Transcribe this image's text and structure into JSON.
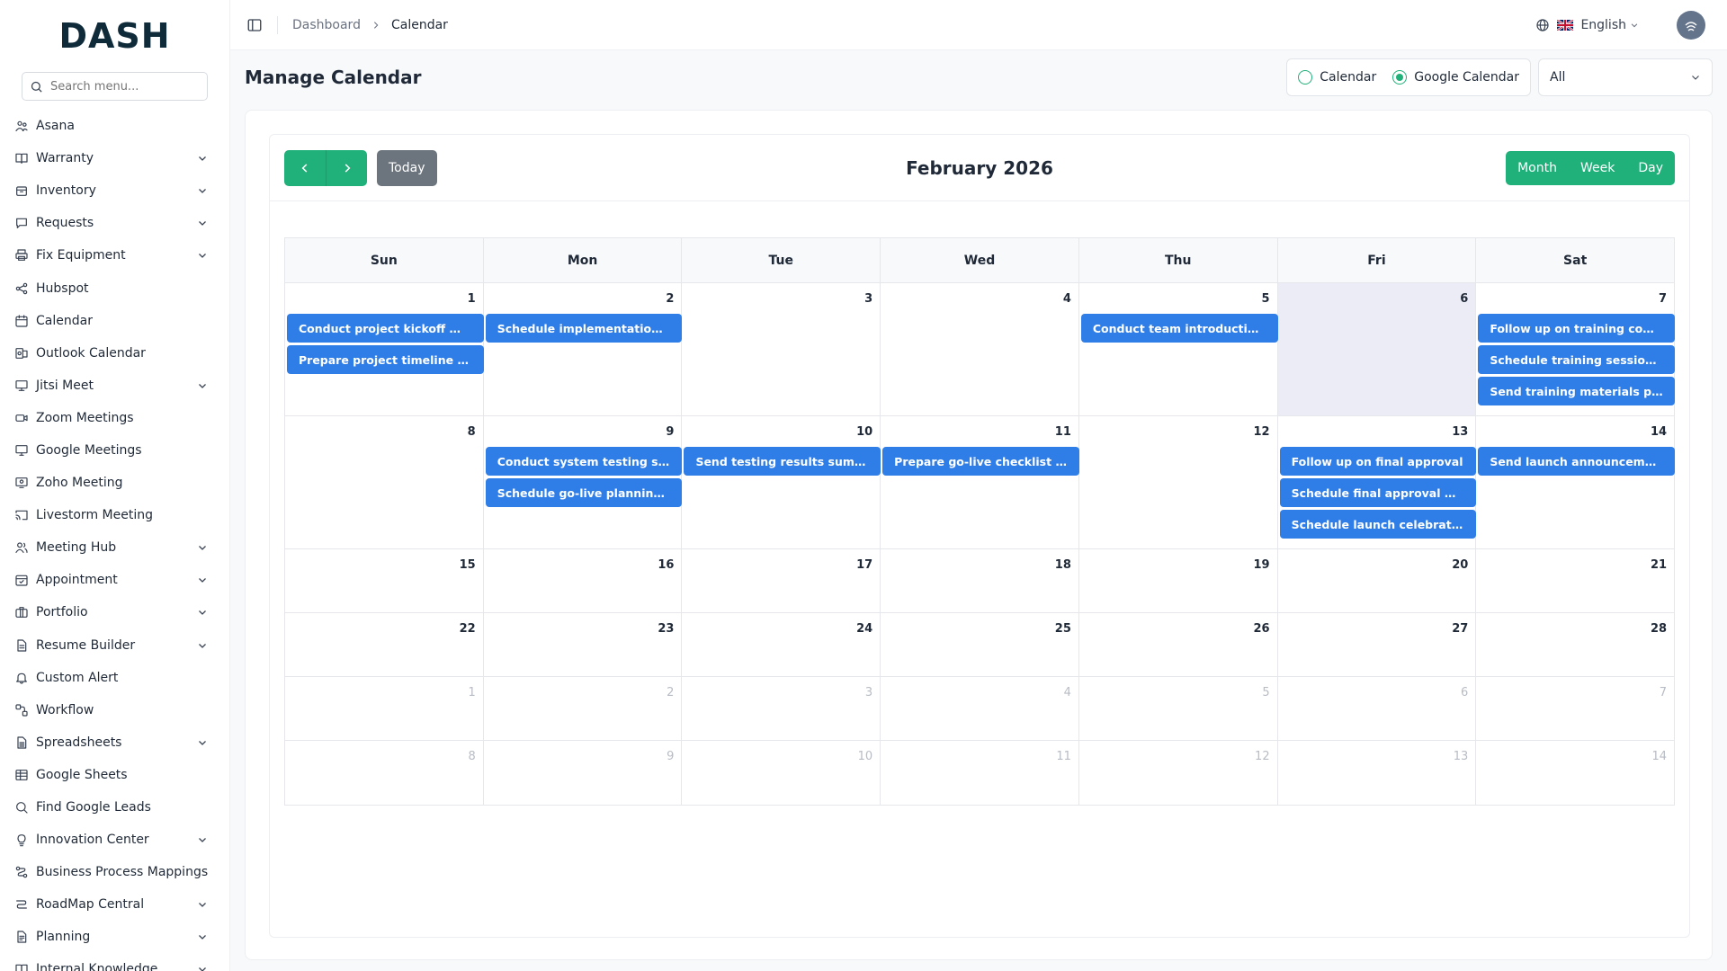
{
  "brand": {
    "logo": "DASH"
  },
  "search": {
    "placeholder": "Search menu..."
  },
  "sidebar": {
    "items": [
      {
        "label": "Asana",
        "icon": "people-icon",
        "chevron": false
      },
      {
        "label": "Warranty",
        "icon": "book-icon",
        "chevron": true
      },
      {
        "label": "Inventory",
        "icon": "box-icon",
        "chevron": true
      },
      {
        "label": "Requests",
        "icon": "message-icon",
        "chevron": true
      },
      {
        "label": "Fix Equipment",
        "icon": "printer-icon",
        "chevron": true
      },
      {
        "label": "Hubspot",
        "icon": "share-icon",
        "chevron": false
      },
      {
        "label": "Calendar",
        "icon": "calendar-icon",
        "chevron": false
      },
      {
        "label": "Outlook Calendar",
        "icon": "outlook-icon",
        "chevron": false
      },
      {
        "label": "Jitsi Meet",
        "icon": "presentation-icon",
        "chevron": true
      },
      {
        "label": "Zoom Meetings",
        "icon": "video-icon",
        "chevron": false
      },
      {
        "label": "Google Meetings",
        "icon": "monitor-icon",
        "chevron": false
      },
      {
        "label": "Zoho Meeting",
        "icon": "screen-share-icon",
        "chevron": false
      },
      {
        "label": "Livestorm Meeting",
        "icon": "cast-icon",
        "chevron": false
      },
      {
        "label": "Meeting Hub",
        "icon": "users-icon",
        "chevron": true
      },
      {
        "label": "Appointment",
        "icon": "calendar-check-icon",
        "chevron": true
      },
      {
        "label": "Portfolio",
        "icon": "briefcase-icon",
        "chevron": true
      },
      {
        "label": "Resume Builder",
        "icon": "file-icon",
        "chevron": true
      },
      {
        "label": "Custom Alert",
        "icon": "bell-icon",
        "chevron": false
      },
      {
        "label": "Workflow",
        "icon": "workflow-icon",
        "chevron": false
      },
      {
        "label": "Spreadsheets",
        "icon": "spreadsheet-icon",
        "chevron": true
      },
      {
        "label": "Google Sheets",
        "icon": "table-icon",
        "chevron": false
      },
      {
        "label": "Find Google Leads",
        "icon": "search-icon",
        "chevron": false
      },
      {
        "label": "Innovation Center",
        "icon": "lightbulb-icon",
        "chevron": true
      },
      {
        "label": "Business Process Mappings",
        "icon": "route-icon",
        "chevron": false
      },
      {
        "label": "RoadMap Central",
        "icon": "roadmap-icon",
        "chevron": true
      },
      {
        "label": "Planning",
        "icon": "file-text-icon",
        "chevron": true
      },
      {
        "label": "Internal Knowledge",
        "icon": "book-open-icon",
        "chevron": true
      }
    ]
  },
  "header": {
    "breadcrumb": {
      "home": "Dashboard",
      "current": "Calendar"
    },
    "language": "English"
  },
  "page": {
    "title": "Manage Calendar",
    "source_options": [
      {
        "label": "Calendar",
        "selected": false
      },
      {
        "label": "Google Calendar",
        "selected": true
      }
    ],
    "filter_value": "All"
  },
  "calendar": {
    "title": "February 2026",
    "today_label": "Today",
    "views": [
      "Month",
      "Week",
      "Day"
    ],
    "weekdays": [
      "Sun",
      "Mon",
      "Tue",
      "Wed",
      "Thu",
      "Fri",
      "Sat"
    ],
    "weeks": [
      {
        "days": [
          {
            "num": "1",
            "other": false,
            "events": [
              "Conduct project kickoff meeting"
            ]
          },
          {
            "num": "2",
            "other": false,
            "events": [
              "Schedule implementation planning"
            ]
          },
          {
            "num": "3",
            "other": false,
            "events": []
          },
          {
            "num": "4",
            "other": false,
            "events": []
          },
          {
            "num": "5",
            "other": false,
            "events": [
              "Conduct team introduction meeting"
            ]
          },
          {
            "num": "6",
            "other": false,
            "today": true,
            "events": []
          },
          {
            "num": "7",
            "other": false,
            "events": [
              "Follow up on training completion",
              "Schedule training session approval",
              "Send training materials package"
            ]
          }
        ],
        "extra": [
          {
            "day": 0,
            "slot": 1,
            "text": "Prepare project timeline document"
          }
        ]
      },
      {
        "days": [
          {
            "num": "8",
            "other": false,
            "events": []
          },
          {
            "num": "9",
            "other": false,
            "events": [
              "Conduct system testing session",
              "Schedule go-live planning meeting"
            ]
          },
          {
            "num": "10",
            "other": false,
            "events": [
              "Send testing results summary"
            ]
          },
          {
            "num": "11",
            "other": false,
            "events": [
              "Prepare go-live checklist document"
            ]
          },
          {
            "num": "12",
            "other": false,
            "events": []
          },
          {
            "num": "13",
            "other": false,
            "events": [
              "Follow up on final approval",
              "Schedule final approval meeting",
              "Schedule launch celebration event"
            ]
          },
          {
            "num": "14",
            "other": false,
            "events": [
              "Send launch announcement communication"
            ]
          }
        ]
      },
      {
        "days": [
          {
            "num": "15",
            "other": false,
            "events": []
          },
          {
            "num": "16",
            "other": false,
            "events": []
          },
          {
            "num": "17",
            "other": false,
            "events": []
          },
          {
            "num": "18",
            "other": false,
            "events": []
          },
          {
            "num": "19",
            "other": false,
            "events": []
          },
          {
            "num": "20",
            "other": false,
            "events": []
          },
          {
            "num": "21",
            "other": false,
            "events": []
          }
        ]
      },
      {
        "days": [
          {
            "num": "22",
            "other": false,
            "events": []
          },
          {
            "num": "23",
            "other": false,
            "events": []
          },
          {
            "num": "24",
            "other": false,
            "events": []
          },
          {
            "num": "25",
            "other": false,
            "events": []
          },
          {
            "num": "26",
            "other": false,
            "events": []
          },
          {
            "num": "27",
            "other": false,
            "events": []
          },
          {
            "num": "28",
            "other": false,
            "events": []
          }
        ]
      },
      {
        "days": [
          {
            "num": "1",
            "other": true,
            "events": []
          },
          {
            "num": "2",
            "other": true,
            "events": []
          },
          {
            "num": "3",
            "other": true,
            "events": []
          },
          {
            "num": "4",
            "other": true,
            "events": []
          },
          {
            "num": "5",
            "other": true,
            "events": []
          },
          {
            "num": "6",
            "other": true,
            "events": []
          },
          {
            "num": "7",
            "other": true,
            "events": []
          }
        ]
      },
      {
        "days": [
          {
            "num": "8",
            "other": true,
            "events": []
          },
          {
            "num": "9",
            "other": true,
            "events": []
          },
          {
            "num": "10",
            "other": true,
            "events": []
          },
          {
            "num": "11",
            "other": true,
            "events": []
          },
          {
            "num": "12",
            "other": true,
            "events": []
          },
          {
            "num": "13",
            "other": true,
            "events": []
          },
          {
            "num": "14",
            "other": true,
            "events": []
          }
        ]
      }
    ]
  },
  "colors": {
    "primary": "#20b07a",
    "event": "#2f7ee8",
    "today_bg": "#ececf7",
    "secondary": "#6c757d"
  }
}
